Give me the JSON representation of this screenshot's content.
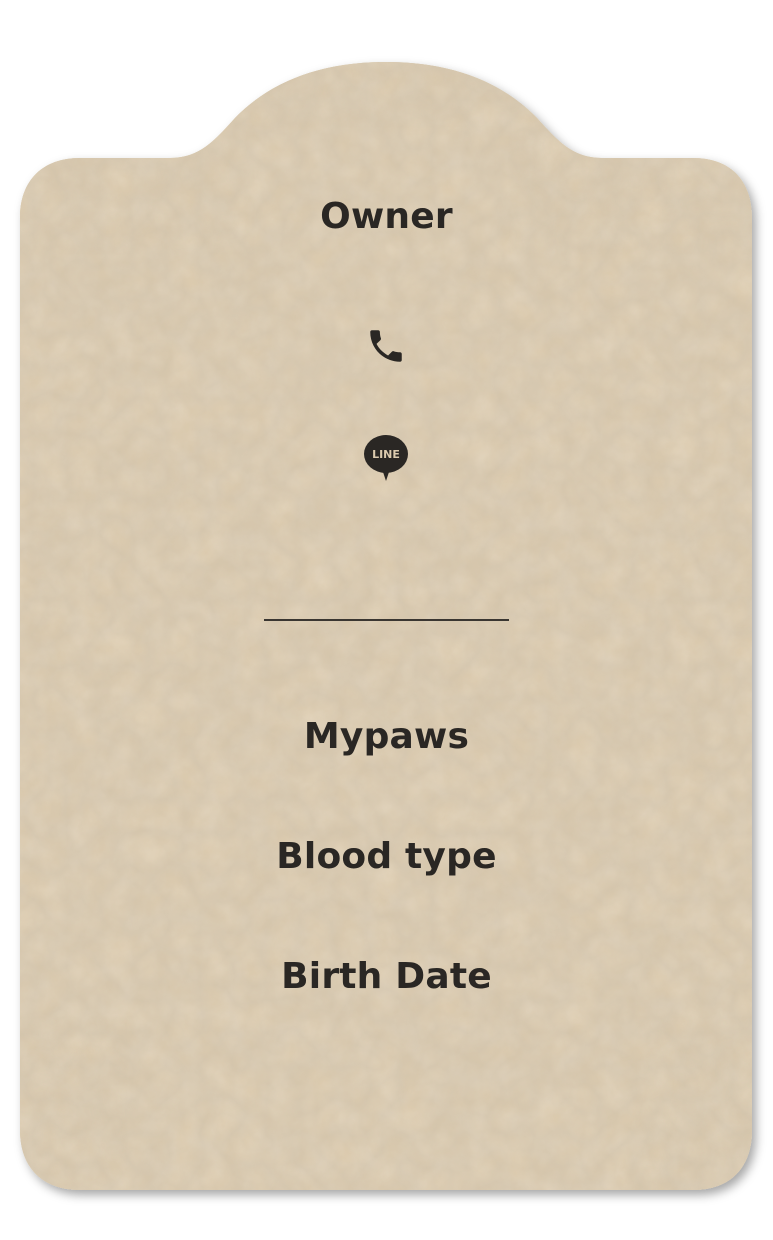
{
  "tag": {
    "owner_label": "Owner",
    "name": "Mypaws",
    "blood_type_label": "Blood type",
    "birth_date_label": "Birth Date"
  },
  "contacts": {
    "phone_icon": "phone-icon",
    "line_icon": "line-app-icon",
    "line_text": "LINE"
  },
  "colors": {
    "leather": "#d9c8ad",
    "text": "#2a2724",
    "icon": "#2a2724"
  }
}
